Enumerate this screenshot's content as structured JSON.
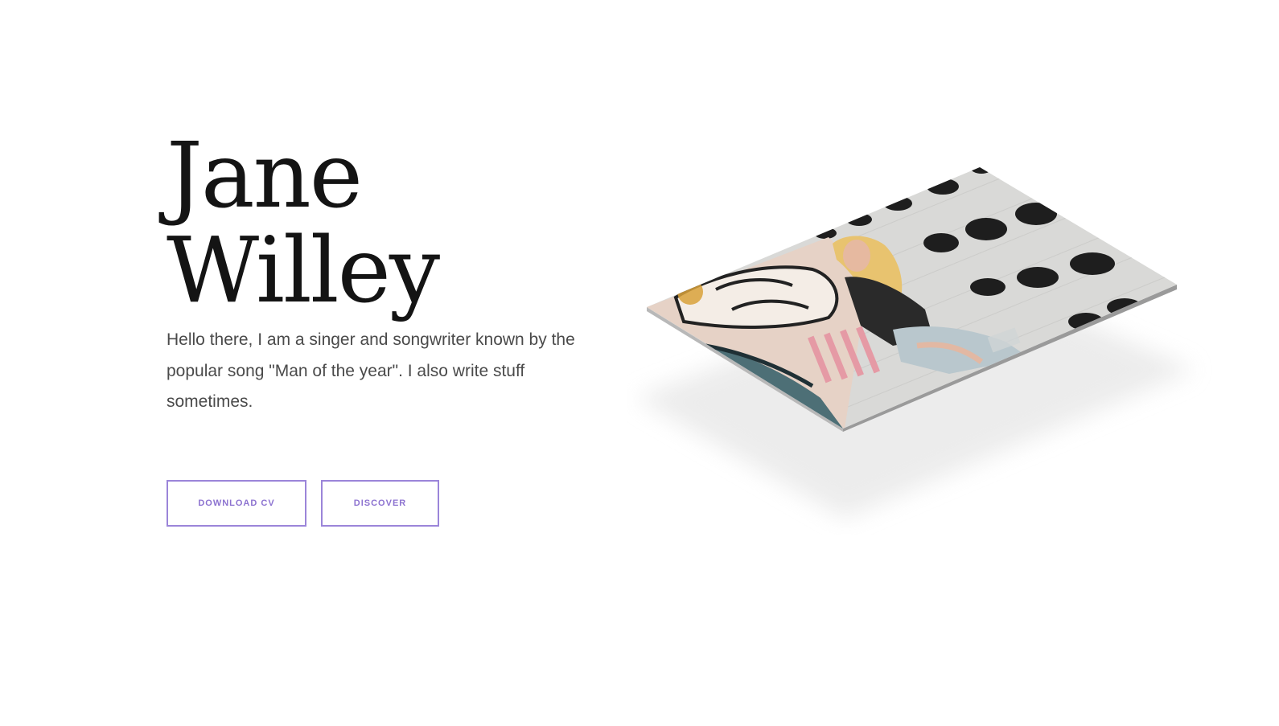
{
  "hero": {
    "first_name": "Jane",
    "last_name": "Willey",
    "intro": "Hello there, I am a singer and songwriter known by the popular song \"Man of the year\". I also write stuff sometimes."
  },
  "buttons": {
    "download_label": "DOWNLOAD CV",
    "discover_label": "DISCOVER"
  },
  "colors": {
    "accent": "#8c72d0",
    "heading": "#141414",
    "body_text": "#4a4a4a"
  }
}
